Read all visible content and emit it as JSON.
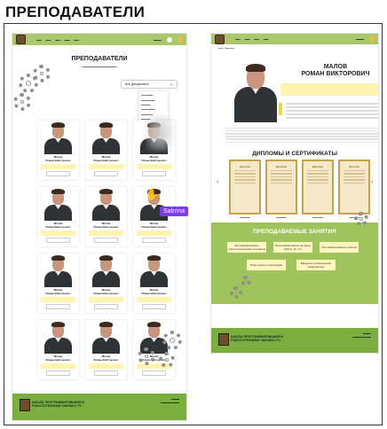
{
  "heading": "ПРЕПОДАВАТЕЛИ",
  "colors": {
    "accent_green": "#a8c86a",
    "footer_green": "#7cad3f",
    "highlight_yellow": "#fff3b0",
    "cursor_purple": "#7b3cf0"
  },
  "left": {
    "title": "ПРЕПОДАВАТЕЛИ",
    "filter": {
      "label": "Все Дисциплины",
      "chevron": "⌄"
    },
    "cards": [
      {
        "name": "Малов\nРоман Викторович"
      },
      {
        "name": "Малов\nРоман Викторович"
      },
      {
        "name": "Малов\nРоман Викторович"
      },
      {
        "name": "Малов\nРоман Викторович"
      },
      {
        "name": "Малов\nРоман Викторович"
      },
      {
        "name": "Малов\nРоман Викторович"
      },
      {
        "name": "Малов\nРоман Викторович"
      },
      {
        "name": "Малов\nРоман Викторович"
      },
      {
        "name": "Малов\nРоман Викторович"
      },
      {
        "name": "Малов\nРоман Викторович"
      },
      {
        "name": "Малов\nРоман Викторович"
      },
      {
        "name": "Малов\nРоман Викторович"
      }
    ],
    "footer": {
      "school": "ШКОЛА ПРОГРАММИРОВАНИЯ И\nРОБОТОТЕХНИКИ «ВИЗИКС IT»"
    }
  },
  "cursor": {
    "user": "Sabrina"
  },
  "right": {
    "name": "МАЛОВ\nРОМАН ВИКТОРОВИЧ",
    "diplomas_title": "ДИПЛОМЫ И СЕРТИФИКАТЫ",
    "diploma_word": "Диплом",
    "lessons_title": "ПРЕПОДАВАЕМЫЕ ЗАНЯТИЯ",
    "lessons": [
      "Программирование\nробототехнических платформ",
      "Программирование на языке\nPython, 8+ лет",
      "Программирование роботов",
      "Подготовка к олимпиадам",
      "Введение в инженерную\nинформатику"
    ],
    "footer": {
      "school": "ШКОЛА ПРОГРАММИРОВАНИЯ И\nРОБОТОТЕХНИКИ «ВИЗИКС IT»"
    }
  }
}
